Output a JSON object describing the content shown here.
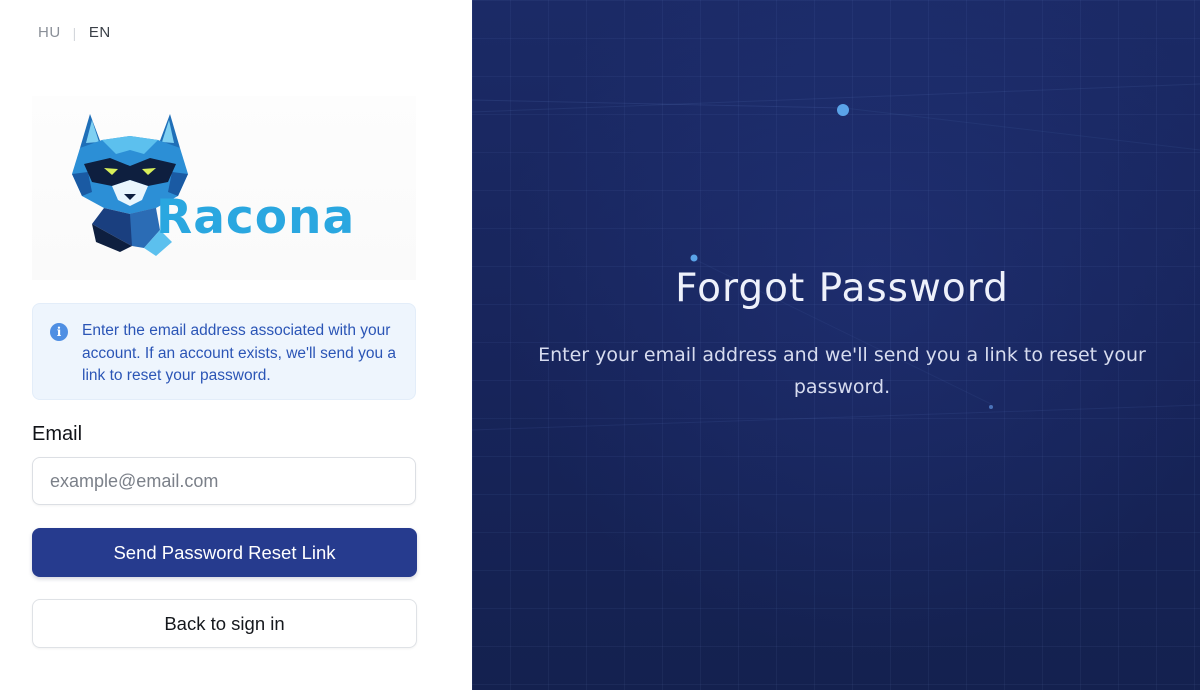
{
  "language": {
    "options": [
      "HU",
      "EN"
    ],
    "selected": "EN"
  },
  "brand": {
    "name": "Racona",
    "logo_icon": "raccoon-logo-icon"
  },
  "info": {
    "icon": "info-icon",
    "message": "Enter the email address associated with your account. If an account exists, we'll send you a link to reset your password."
  },
  "form": {
    "email_label": "Email",
    "email_placeholder": "example@email.com",
    "email_value": "",
    "submit_label": "Send Password Reset Link",
    "back_label": "Back to sign in"
  },
  "hero": {
    "title": "Forgot Password",
    "subtitle": "Enter your email address and we'll send you a link to reset your password."
  },
  "colors": {
    "primary_button": "#263b8e",
    "info_background": "#eef5fd",
    "info_text": "#2b55b6",
    "hero_background": "#1b2a66",
    "brand_text": "#2aa7e0"
  }
}
